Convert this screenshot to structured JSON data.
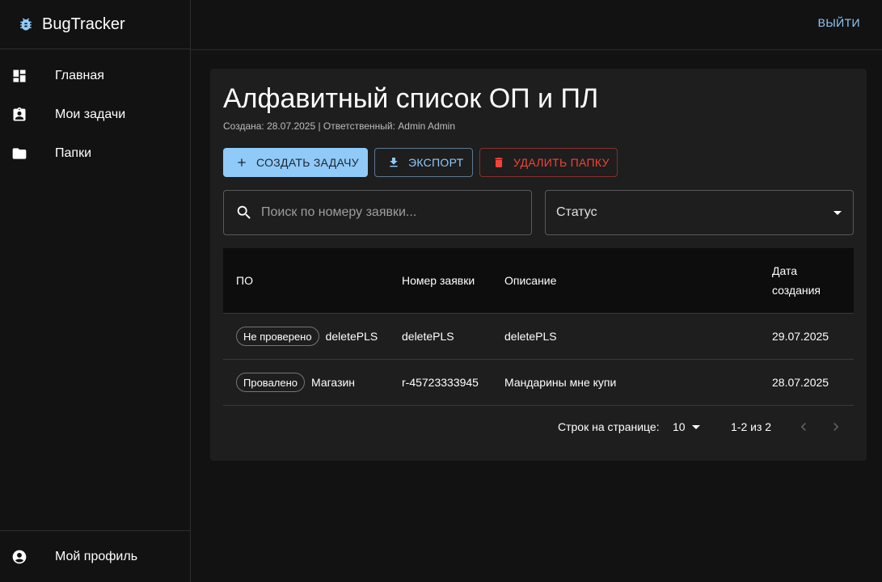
{
  "app": {
    "title": "BugTracker"
  },
  "sidebar": {
    "items": [
      {
        "label": "Главная",
        "icon": "dashboard-icon"
      },
      {
        "label": "Мои задачи",
        "icon": "assignment-icon"
      },
      {
        "label": "Папки",
        "icon": "folder-icon"
      }
    ],
    "profile": {
      "label": "Мой профиль",
      "icon": "account-circle-icon"
    }
  },
  "topbar": {
    "logout_label": "ВЫЙТИ"
  },
  "folder": {
    "title": "Алфавитный список ОП и ПЛ",
    "meta": "Создана: 28.07.2025 | Ответственный: Admin Admin"
  },
  "actions": {
    "create_label": "СОЗДАТЬ ЗАДАЧУ",
    "export_label": "ЭКСПОРТ",
    "delete_label": "УДАЛИТЬ ПАПКУ"
  },
  "filters": {
    "search_placeholder": "Поиск по номеру заявки...",
    "search_value": "",
    "status_label": "Статус"
  },
  "table": {
    "headers": {
      "po": "ПО",
      "number": "Номер заявки",
      "description": "Описание",
      "date_line1": "Дата",
      "date_line2": "создания"
    },
    "rows": [
      {
        "status": "Не проверено",
        "po": "deletePLS",
        "number": "deletePLS",
        "description": "deletePLS",
        "date": "29.07.2025"
      },
      {
        "status": "Провалено",
        "po": "Магазин",
        "number": "r-45723333945",
        "description": "Мандарины мне купи",
        "date": "28.07.2025"
      }
    ]
  },
  "pagination": {
    "rows_per_page_label": "Строк на странице:",
    "rows_per_page": "10",
    "range": "1-2 из 2"
  },
  "colors": {
    "background": "#121212",
    "card": "#1e1e1e",
    "primary": "#90caf9",
    "danger": "#f44336"
  }
}
